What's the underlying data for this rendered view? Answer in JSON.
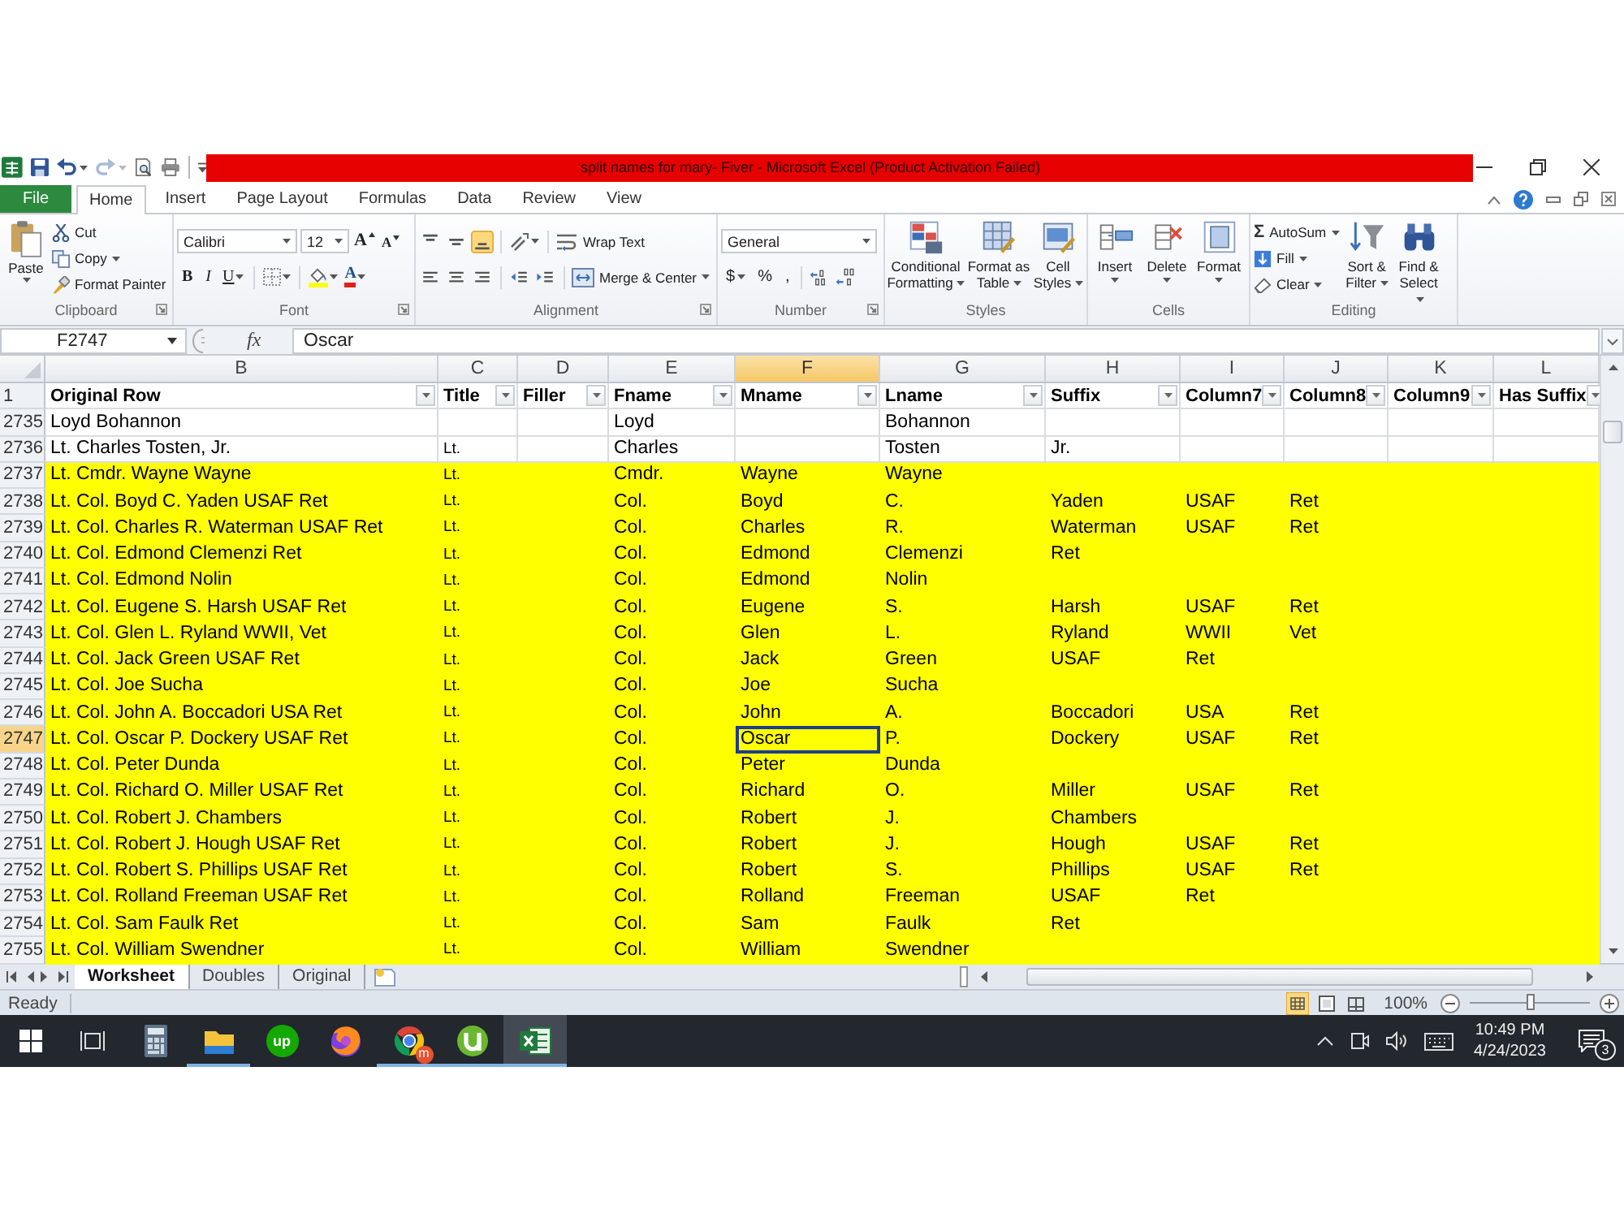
{
  "window": {
    "title": "split names for mary- Fiver - Microsoft Excel (Product Activation Failed)"
  },
  "quick_access": [
    {
      "kind": "save",
      "disabled": false
    },
    {
      "kind": "undo",
      "disabled": false
    },
    {
      "kind": "redo",
      "disabled": true
    },
    {
      "kind": "print_preview",
      "disabled": false
    },
    {
      "kind": "print",
      "disabled": false
    }
  ],
  "ribbon_tabs": [
    {
      "label": "File",
      "kind": "file",
      "selected": false
    },
    {
      "label": "Home",
      "kind": "tab",
      "selected": true
    },
    {
      "label": "Insert",
      "kind": "tab",
      "selected": false
    },
    {
      "label": "Page Layout",
      "kind": "tab",
      "selected": false
    },
    {
      "label": "Formulas",
      "kind": "tab",
      "selected": false
    },
    {
      "label": "Data",
      "kind": "tab",
      "selected": false
    },
    {
      "label": "Review",
      "kind": "tab",
      "selected": false
    },
    {
      "label": "View",
      "kind": "tab",
      "selected": false
    }
  ],
  "ribbon": {
    "clipboard": {
      "label": "Clipboard",
      "paste": "Paste",
      "cut": "Cut",
      "copy": "Copy",
      "format_painter": "Format Painter"
    },
    "font": {
      "label": "Font",
      "font_name": "Calibri",
      "font_size": "12",
      "grow_font": "A",
      "shrink_font": "A",
      "bold": "B",
      "italic": "I",
      "underline": "U",
      "font_color": "A"
    },
    "alignment": {
      "label": "Alignment",
      "vertical": [
        {
          "kind": "top",
          "selected": false
        },
        {
          "kind": "middle",
          "selected": false
        },
        {
          "kind": "bottom",
          "selected": true
        }
      ],
      "wrap_text": "Wrap Text",
      "merge_center": "Merge & Center"
    },
    "number": {
      "label": "Number",
      "format": "General",
      "currency": "$",
      "percent": "%",
      "comma": ","
    },
    "styles": {
      "label": "Styles",
      "buttons": [
        {
          "kind": "conditional",
          "label": "Conditional Formatting"
        },
        {
          "kind": "table",
          "label": "Format as Table"
        },
        {
          "kind": "cell_styles",
          "label": "Cell Styles"
        }
      ]
    },
    "cells": {
      "label": "Cells",
      "buttons": [
        {
          "kind": "insert",
          "label": "Insert"
        },
        {
          "kind": "delete",
          "label": "Delete"
        },
        {
          "kind": "format",
          "label": "Format"
        }
      ]
    },
    "editing": {
      "label": "Editing",
      "sum_sign": "Σ",
      "autosum": "AutoSum",
      "fill": "Fill",
      "clear": "Clear",
      "sort_filter": "Sort & Filter",
      "find_select": "Find & Select"
    }
  },
  "formula_bar": {
    "name_box": "F2747",
    "function_label": "fx",
    "value": "Oscar"
  },
  "table": {
    "header_row_number": "1",
    "columns": [
      {
        "letter": "B",
        "header": "Original Row",
        "selected": false
      },
      {
        "letter": "C",
        "header": "Title",
        "selected": false
      },
      {
        "letter": "D",
        "header": "Filler",
        "selected": false
      },
      {
        "letter": "E",
        "header": "Fname",
        "selected": false
      },
      {
        "letter": "F",
        "header": "Mname",
        "selected": true
      },
      {
        "letter": "G",
        "header": "Lname",
        "selected": false
      },
      {
        "letter": "H",
        "header": "Suffix",
        "selected": false
      },
      {
        "letter": "I",
        "header": "Column7",
        "selected": false
      },
      {
        "letter": "J",
        "header": "Column8",
        "selected": false
      },
      {
        "letter": "K",
        "header": "Column9",
        "selected": false
      },
      {
        "letter": "L",
        "header": "Has Suffix",
        "selected": false
      }
    ],
    "rows": [
      {
        "number": "2735",
        "highlighted": false,
        "selected": false,
        "original_row": "Loyd Bohannon",
        "fname": "Loyd",
        "lname": "Bohannon"
      },
      {
        "number": "2736",
        "highlighted": false,
        "selected": false,
        "original_row": "Lt. Charles Tosten, Jr.",
        "title": "Lt.",
        "fname": "Charles",
        "lname": "Tosten",
        "suffix": "Jr."
      },
      {
        "number": "2737",
        "highlighted": true,
        "selected": false,
        "original_row": "Lt. Cmdr. Wayne Wayne",
        "title": "Lt.",
        "fname": "Cmdr.",
        "mname": "Wayne",
        "lname": "Wayne"
      },
      {
        "number": "2738",
        "highlighted": true,
        "selected": false,
        "original_row": "Lt. Col. Boyd C. Yaden USAF Ret",
        "title": "Lt.",
        "fname": "Col.",
        "mname": "Boyd",
        "lname": "C.",
        "suffix": "Yaden",
        "column7": "USAF",
        "column8": "Ret"
      },
      {
        "number": "2739",
        "highlighted": true,
        "selected": false,
        "original_row": "Lt. Col. Charles R. Waterman USAF Ret",
        "title": "Lt.",
        "fname": "Col.",
        "mname": "Charles",
        "lname": "R.",
        "suffix": "Waterman",
        "column7": "USAF",
        "column8": "Ret"
      },
      {
        "number": "2740",
        "highlighted": true,
        "selected": false,
        "original_row": "Lt. Col. Edmond Clemenzi Ret",
        "title": "Lt.",
        "fname": "Col.",
        "mname": "Edmond",
        "lname": "Clemenzi",
        "suffix": "Ret"
      },
      {
        "number": "2741",
        "highlighted": true,
        "selected": false,
        "original_row": "Lt. Col. Edmond Nolin",
        "title": "Lt.",
        "fname": "Col.",
        "mname": "Edmond",
        "lname": "Nolin"
      },
      {
        "number": "2742",
        "highlighted": true,
        "selected": false,
        "original_row": "Lt. Col. Eugene S. Harsh USAF Ret",
        "title": "Lt.",
        "fname": "Col.",
        "mname": "Eugene",
        "lname": "S.",
        "suffix": "Harsh",
        "column7": "USAF",
        "column8": "Ret"
      },
      {
        "number": "2743",
        "highlighted": true,
        "selected": false,
        "original_row": "Lt. Col. Glen L. Ryland WWII, Vet",
        "title": "Lt.",
        "fname": "Col.",
        "mname": "Glen",
        "lname": "L.",
        "suffix": "Ryland",
        "column7": "WWII",
        "column8": "Vet"
      },
      {
        "number": "2744",
        "highlighted": true,
        "selected": false,
        "original_row": "Lt. Col. Jack Green USAF Ret",
        "title": "Lt.",
        "fname": "Col.",
        "mname": "Jack",
        "lname": "Green",
        "suffix": "USAF",
        "column7": "Ret"
      },
      {
        "number": "2745",
        "highlighted": true,
        "selected": false,
        "original_row": "Lt. Col. Joe Sucha",
        "title": "Lt.",
        "fname": "Col.",
        "mname": "Joe",
        "lname": "Sucha"
      },
      {
        "number": "2746",
        "highlighted": true,
        "selected": false,
        "original_row": "Lt. Col. John A. Boccadori USA Ret",
        "title": "Lt.",
        "fname": "Col.",
        "mname": "John",
        "lname": "A.",
        "suffix": "Boccadori",
        "column7": "USA",
        "column8": "Ret"
      },
      {
        "number": "2747",
        "highlighted": true,
        "selected": true,
        "original_row": "Lt. Col. Oscar P. Dockery USAF Ret",
        "title": "Lt.",
        "fname": "Col.",
        "mname": "Oscar",
        "lname": "P.",
        "suffix": "Dockery",
        "column7": "USAF",
        "column8": "Ret"
      },
      {
        "number": "2748",
        "highlighted": true,
        "selected": false,
        "original_row": "Lt. Col. Peter Dunda",
        "title": "Lt.",
        "fname": "Col.",
        "mname": "Peter",
        "lname": "Dunda"
      },
      {
        "number": "2749",
        "highlighted": true,
        "selected": false,
        "original_row": "Lt. Col. Richard O. Miller USAF Ret",
        "title": "Lt.",
        "fname": "Col.",
        "mname": "Richard",
        "lname": "O.",
        "suffix": "Miller",
        "column7": "USAF",
        "column8": "Ret"
      },
      {
        "number": "2750",
        "highlighted": true,
        "selected": false,
        "original_row": "Lt. Col. Robert J. Chambers",
        "title": "Lt.",
        "fname": "Col.",
        "mname": "Robert",
        "lname": "J.",
        "suffix": "Chambers"
      },
      {
        "number": "2751",
        "highlighted": true,
        "selected": false,
        "original_row": "Lt. Col. Robert J. Hough USAF Ret",
        "title": "Lt.",
        "fname": "Col.",
        "mname": "Robert",
        "lname": "J.",
        "suffix": "Hough",
        "column7": "USAF",
        "column8": "Ret"
      },
      {
        "number": "2752",
        "highlighted": true,
        "selected": false,
        "original_row": "Lt. Col. Robert S. Phillips USAF Ret",
        "title": "Lt.",
        "fname": "Col.",
        "mname": "Robert",
        "lname": "S.",
        "suffix": "Phillips",
        "column7": "USAF",
        "column8": "Ret"
      },
      {
        "number": "2753",
        "highlighted": true,
        "selected": false,
        "original_row": "Lt. Col. Rolland Freeman USAF Ret",
        "title": "Lt.",
        "fname": "Col.",
        "mname": "Rolland",
        "lname": "Freeman",
        "suffix": "USAF",
        "column7": "Ret"
      },
      {
        "number": "2754",
        "highlighted": true,
        "selected": false,
        "original_row": "Lt. Col. Sam Faulk Ret",
        "title": "Lt.",
        "fname": "Col.",
        "mname": "Sam",
        "lname": "Faulk",
        "suffix": "Ret"
      },
      {
        "number": "2755",
        "highlighted": true,
        "selected": false,
        "original_row": "Lt. Col. William Swendner",
        "title": "Lt.",
        "fname": "Col.",
        "mname": "William",
        "lname": "Swendner"
      }
    ]
  },
  "sheet_tabs": [
    {
      "label": "Worksheet",
      "selected": true
    },
    {
      "label": "Doubles",
      "selected": false
    },
    {
      "label": "Original",
      "selected": false
    }
  ],
  "status_bar": {
    "text": "Ready",
    "views": [
      {
        "kind": "normal",
        "selected": true
      },
      {
        "kind": "page_layout",
        "selected": false
      },
      {
        "kind": "page_break",
        "selected": false
      }
    ],
    "zoom": "100%",
    "zoom_slider": {
      "level": 0.5
    }
  },
  "taskbar": {
    "apps": [
      {
        "kind": "calculator",
        "running": false,
        "selected": false
      },
      {
        "kind": "folder",
        "running": true,
        "selected": false
      },
      {
        "kind": "letters",
        "label": "up",
        "running": false,
        "selected": false
      },
      {
        "kind": "fox",
        "running": false,
        "selected": false
      },
      {
        "kind": "chrome",
        "badge": "m",
        "running": true,
        "selected": false
      },
      {
        "kind": "torrent",
        "running": true,
        "selected": false
      },
      {
        "kind": "spreadsheet",
        "running": true,
        "selected": true
      }
    ],
    "time": "10:49 PM",
    "date": "4/24/2023",
    "notifications": "3"
  }
}
